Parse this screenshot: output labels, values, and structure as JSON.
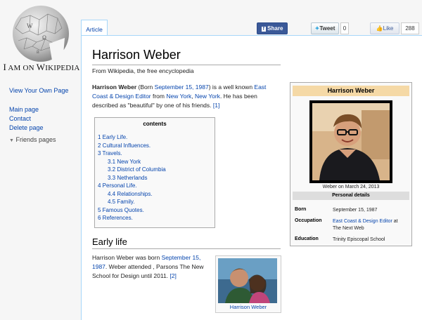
{
  "logo": {
    "text_i": "I",
    "text_am": "AM",
    "text_on": "ON",
    "text_w": "W",
    "text_ikipedia": "IKIPEDIA"
  },
  "sidebar": {
    "view_own_page": "View Your Own Page",
    "main_page": "Main page",
    "contact": "Contact",
    "delete_page": "Delete page",
    "friends_pages": "Friends pages"
  },
  "tabs": {
    "article": "Article"
  },
  "social": {
    "share_label": "Share",
    "tweet_label": "Tweet",
    "tweet_count": "0",
    "like_label": "Like",
    "like_count": "288",
    "colors": {
      "facebook": "#3b5998",
      "twitter_text": "#333333"
    }
  },
  "article": {
    "title": "Harrison Weber",
    "tagline": "From Wikipedia, the free encyclopedia",
    "intro": {
      "bold_name": "Harrison Weber",
      "born_prefix": " (Born ",
      "born_date": "September 15, 1987",
      "born_suffix": ") is a well known ",
      "role": "East Coast & Design Editor",
      "from": " from ",
      "city": "New York",
      "comma": ", ",
      "city2": "New York",
      "rest": ". He has been described as \"beautiful\" by one of his friends. ",
      "ref": "[1]"
    },
    "toc": {
      "title": "contents",
      "items": [
        "1 Early Life.",
        "2 Cultural Influences.",
        "3 Travels.",
        "3.1 New York",
        "3.2 District of Columbia",
        "3.3 Netherlands",
        "4 Personal Life.",
        "4.4 Relationships.",
        "4.5 Family.",
        "5 Famous Quotes.",
        "6 References."
      ]
    },
    "early_life": {
      "heading": "Early life",
      "p1": "Harrison Weber was born ",
      "p_date": "September 15, 1987",
      "p2": ". Weber attended , Parsons The New School for Design until 2011. ",
      "ref": "[2]",
      "thumb_caption": "Harrison Weber"
    },
    "infobox": {
      "heading": "Harrison Weber",
      "photo_caption": "Weber on March 24, 2013",
      "subheading": "Personal details",
      "rows": [
        {
          "label": "Born",
          "value": "September 15, 1987"
        },
        {
          "label": "Occupation",
          "value": "East Coast & Design Editor",
          "value2": " at The Next Web"
        },
        {
          "label": "Education",
          "value": "Trinity Episcopal School"
        }
      ]
    }
  }
}
